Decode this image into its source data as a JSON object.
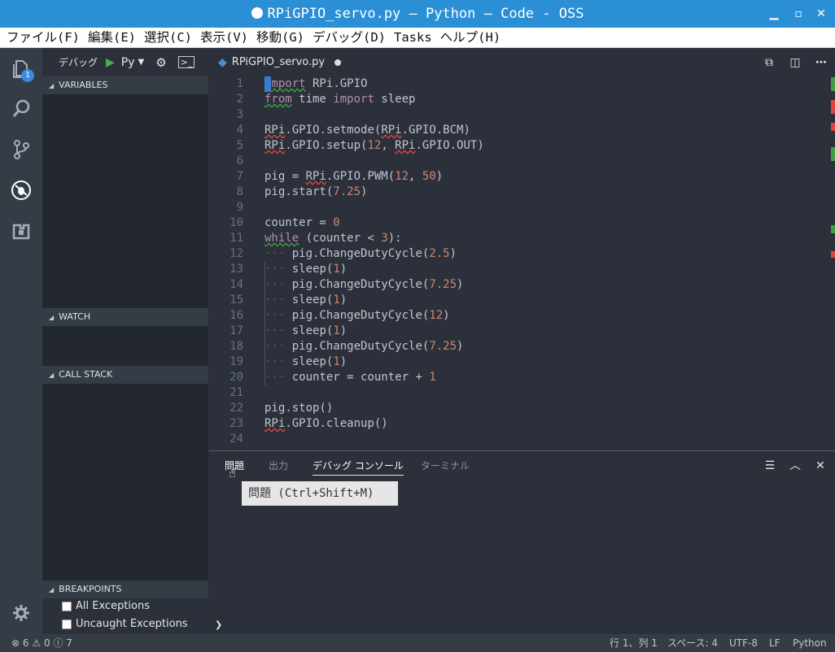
{
  "window": {
    "title": "RPiGPIO_servo.py — Python — Code - OSS"
  },
  "menu": [
    "ファイル(F)",
    "編集(E)",
    "選択(C)",
    "表示(V)",
    "移動(G)",
    "デバッグ(D)",
    "Tasks",
    "ヘルプ(H)"
  ],
  "activity": {
    "explorer_badge": "1"
  },
  "debug_toolbar": {
    "label": "デバッグ",
    "config": "Py"
  },
  "sidebar_sections": {
    "variables": "VARIABLES",
    "watch": "WATCH",
    "call_stack": "CALL STACK",
    "breakpoints": "BREAKPOINTS"
  },
  "breakpoints": [
    {
      "label": "All Exceptions",
      "checked": false
    },
    {
      "label": "Uncaught Exceptions",
      "checked": false
    }
  ],
  "editor_tab": {
    "filename": "RPiGPIO_servo.py"
  },
  "code_lines": [
    [
      [
        "kw sq sq-g",
        "import"
      ],
      [
        "id",
        " RPi.GPIO"
      ]
    ],
    [
      [
        "kw sq sq-g",
        "from"
      ],
      [
        "id",
        " time "
      ],
      [
        "kw",
        "import"
      ],
      [
        "id",
        " sleep"
      ]
    ],
    [],
    [
      [
        "id sq sq-r",
        "RPi"
      ],
      [
        "id",
        ".GPIO.setmode("
      ],
      [
        "id sq sq-r",
        "RPi"
      ],
      [
        "id",
        ".GPIO.BCM)"
      ]
    ],
    [
      [
        "id sq sq-r",
        "RPi"
      ],
      [
        "id",
        ".GPIO.setup("
      ],
      [
        "num",
        "12"
      ],
      [
        "id",
        ", "
      ],
      [
        "id sq sq-r",
        "RPi"
      ],
      [
        "id",
        ".GPIO.OUT)"
      ]
    ],
    [],
    [
      [
        "id",
        "pig = "
      ],
      [
        "id sq sq-r",
        "RPi"
      ],
      [
        "id",
        ".GPIO.PWM("
      ],
      [
        "num",
        "12"
      ],
      [
        "id",
        ", "
      ],
      [
        "num",
        "50"
      ],
      [
        "id",
        ")"
      ]
    ],
    [
      [
        "id",
        "pig.start("
      ],
      [
        "num",
        "7.25"
      ],
      [
        "id",
        ")"
      ]
    ],
    [],
    [
      [
        "id",
        "counter = "
      ],
      [
        "num",
        "0"
      ]
    ],
    [
      [
        "kw sq sq-g",
        "while"
      ],
      [
        "id",
        " (counter < "
      ],
      [
        "num",
        "3"
      ],
      [
        "id",
        "):"
      ]
    ],
    [
      [
        "ws",
        "···"
      ],
      [
        "id",
        " pig.ChangeDutyCycle("
      ],
      [
        "num",
        "2.5"
      ],
      [
        "id",
        ")"
      ]
    ],
    [
      [
        "ws",
        "···"
      ],
      [
        "id",
        " sleep("
      ],
      [
        "num",
        "1"
      ],
      [
        "id",
        ")"
      ]
    ],
    [
      [
        "ws",
        "···"
      ],
      [
        "id",
        " pig.ChangeDutyCycle("
      ],
      [
        "num",
        "7.25"
      ],
      [
        "id",
        ")"
      ]
    ],
    [
      [
        "ws",
        "···"
      ],
      [
        "id",
        " sleep("
      ],
      [
        "num",
        "1"
      ],
      [
        "id",
        ")"
      ]
    ],
    [
      [
        "ws",
        "···"
      ],
      [
        "id",
        " pig.ChangeDutyCycle("
      ],
      [
        "num",
        "12"
      ],
      [
        "id",
        ")"
      ]
    ],
    [
      [
        "ws",
        "···"
      ],
      [
        "id",
        " sleep("
      ],
      [
        "num",
        "1"
      ],
      [
        "id",
        ")"
      ]
    ],
    [
      [
        "ws",
        "···"
      ],
      [
        "id",
        " pig.ChangeDutyCycle("
      ],
      [
        "num",
        "7.25"
      ],
      [
        "id",
        ")"
      ]
    ],
    [
      [
        "ws",
        "···"
      ],
      [
        "id",
        " sleep("
      ],
      [
        "num",
        "1"
      ],
      [
        "id",
        ")"
      ]
    ],
    [
      [
        "ws",
        "···"
      ],
      [
        "id",
        " counter = counter + "
      ],
      [
        "num",
        "1"
      ]
    ],
    [],
    [
      [
        "id",
        "pig.stop()"
      ]
    ],
    [
      [
        "id sq sq-r",
        "RPi"
      ],
      [
        "id",
        ".GPIO.cleanup()"
      ]
    ],
    []
  ],
  "panel": {
    "tabs": [
      "問題",
      "出力",
      "デバッグ コンソール",
      "ターミナル"
    ],
    "active_tab": "デバッグ コンソール",
    "tooltip": "問題 (Ctrl+Shift+M)",
    "prompt": "❯"
  },
  "statusbar": {
    "errors": "6",
    "warnings": "0",
    "infos": "7",
    "position": "行 1、列 1",
    "spaces": "スペース: 4",
    "encoding": "UTF-8",
    "eol": "LF",
    "language": "Python"
  },
  "colors": {
    "titlebar": "#2b8fd6",
    "background": "#2b303b",
    "activitybar": "#343d46",
    "keyword": "#b48ead",
    "number": "#d08770"
  }
}
